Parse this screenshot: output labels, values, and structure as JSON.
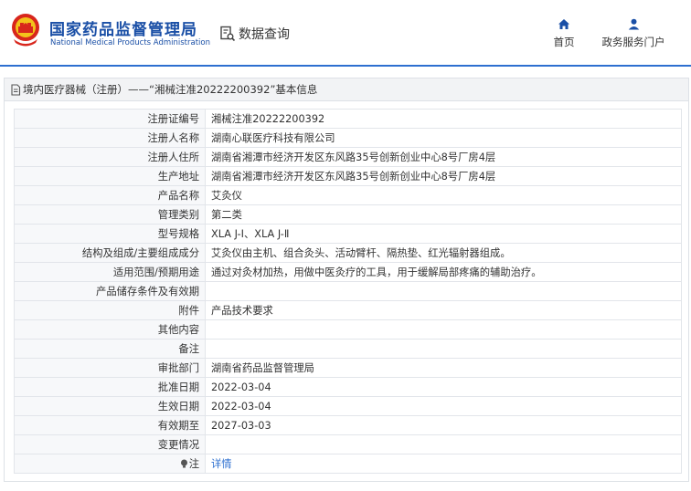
{
  "header": {
    "brand_cn": "国家药品监督管理局",
    "brand_en": "National Medical Products Administration",
    "page_title": "数据查询",
    "nav": [
      {
        "label": "首页",
        "icon": "home-icon"
      },
      {
        "label": "政务服务门户",
        "icon": "user-icon"
      }
    ]
  },
  "breadcrumb": "境内医疗器械（注册）——“湘械注准20222200392”基本信息",
  "rows": [
    {
      "label": "注册证编号",
      "value": "湘械注准20222200392"
    },
    {
      "label": "注册人名称",
      "value": "湖南心联医疗科技有限公司"
    },
    {
      "label": "注册人住所",
      "value": "湖南省湘潭市经济开发区东风路35号创新创业中心8号厂房4层"
    },
    {
      "label": "生产地址",
      "value": "湖南省湘潭市经济开发区东风路35号创新创业中心8号厂房4层"
    },
    {
      "label": "产品名称",
      "value": "艾灸仪"
    },
    {
      "label": "管理类别",
      "value": "第二类"
    },
    {
      "label": "型号规格",
      "value": "XLA J-Ⅰ、XLA J-Ⅱ"
    },
    {
      "label": "结构及组成/主要组成成分",
      "value": "艾灸仪由主机、组合灸头、活动臂杆、隔热垫、红光辐射器组成。"
    },
    {
      "label": "适用范围/预期用途",
      "value": "通过对灸材加热，用做中医灸疗的工具，用于缓解局部疼痛的辅助治疗。"
    },
    {
      "label": "产品储存条件及有效期",
      "value": ""
    },
    {
      "label": "附件",
      "value": "产品技术要求"
    },
    {
      "label": "其他内容",
      "value": ""
    },
    {
      "label": "备注",
      "value": ""
    },
    {
      "label": "审批部门",
      "value": "湖南省药品监督管理局"
    },
    {
      "label": "批准日期",
      "value": "2022-03-04"
    },
    {
      "label": "生效日期",
      "value": "2022-03-04"
    },
    {
      "label": "有效期至",
      "value": "2027-03-03"
    },
    {
      "label": "变更情况",
      "value": ""
    }
  ],
  "note_row": {
    "label": "注",
    "value": "详情",
    "icon": "bulb-icon"
  },
  "colors": {
    "brand_blue": "#1a4fa6",
    "accent_blue": "#2d6fd0",
    "label_bg": "#f7f8fa"
  }
}
